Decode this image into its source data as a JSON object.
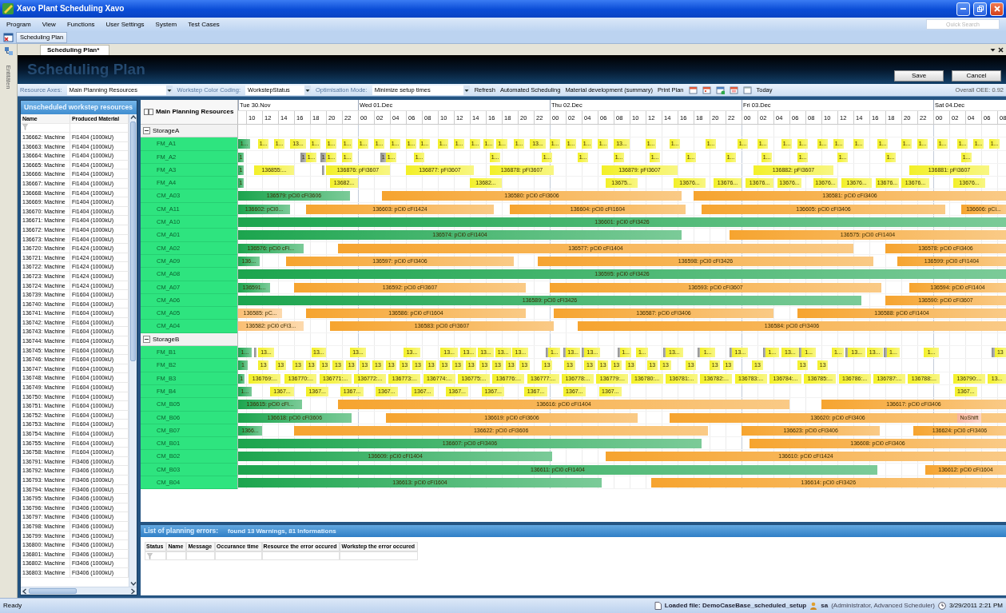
{
  "window": {
    "title": "Xavo Plant Scheduling Xavo"
  },
  "menu": [
    "Program",
    "View",
    "Functions",
    "User Settings",
    "System",
    "Test Cases"
  ],
  "quick_search": {
    "placeholder": "Quick Search"
  },
  "toolbar": {
    "buttons": [
      "Scheduling Plan"
    ]
  },
  "side_strip": {
    "label": "Entitäten"
  },
  "document_tabs": [
    {
      "label": "Scheduling Plan*",
      "selected": true
    }
  ],
  "header": {
    "title": "Scheduling Plan",
    "buttons": [
      "Save",
      "Cancel"
    ]
  },
  "options": {
    "fields": [
      {
        "label": "Resource Axes:",
        "value": "Main Planning Resources"
      },
      {
        "label": "Workstep Color Coding:",
        "value": "WorkstepStatus"
      },
      {
        "label": "Optimisation Mode:",
        "value": "Minimize setup times"
      }
    ],
    "actions": [
      "Refresh",
      "Automated Scheduling",
      "Material development (summary)",
      "Print Plan"
    ],
    "today": "Today",
    "oee_label": "Overall OEE:",
    "oee_value": "0.92"
  },
  "unscheduled": {
    "title": "Unscheduled workstep resources",
    "columns": [
      "Name",
      "Produced Material"
    ],
    "rows": [
      [
        "136662: Machine",
        "Fi1404 (1000kU)"
      ],
      [
        "136663: Machine",
        "Fi1404 (1000kU)"
      ],
      [
        "136664: Machine",
        "Fi1404 (1000kU)"
      ],
      [
        "136665: Machine",
        "Fi1404 (1000kU)"
      ],
      [
        "136666: Machine",
        "Fi1404 (1000kU)"
      ],
      [
        "136667: Machine",
        "Fi1404 (1000kU)"
      ],
      [
        "136668: Machine",
        "Fi1404 (1000kU)"
      ],
      [
        "136669: Machine",
        "Fi1404 (1000kU)"
      ],
      [
        "136670: Machine",
        "Fi1404 (1000kU)"
      ],
      [
        "136671: Machine",
        "Fi1404 (1000kU)"
      ],
      [
        "136672: Machine",
        "Fi1404 (1000kU)"
      ],
      [
        "136673: Machine",
        "Fi1404 (1000kU)"
      ],
      [
        "136720: Machine",
        "Fi1424 (1000kU)"
      ],
      [
        "136721: Machine",
        "Fi1424 (1000kU)"
      ],
      [
        "136722: Machine",
        "Fi1424 (1000kU)"
      ],
      [
        "136723: Machine",
        "Fi1424 (1000kU)"
      ],
      [
        "136724: Machine",
        "Fi1424 (1000kU)"
      ],
      [
        "136739: Machine",
        "Fi1604 (1000kU)"
      ],
      [
        "136740: Machine",
        "Fi1604 (1000kU)"
      ],
      [
        "136741: Machine",
        "Fi1604 (1000kU)"
      ],
      [
        "136742: Machine",
        "Fi1604 (1000kU)"
      ],
      [
        "136743: Machine",
        "Fi1604 (1000kU)"
      ],
      [
        "136744: Machine",
        "Fi1604 (1000kU)"
      ],
      [
        "136745: Machine",
        "Fi1604 (1000kU)"
      ],
      [
        "136746: Machine",
        "Fi1604 (1000kU)"
      ],
      [
        "136747: Machine",
        "Fi1604 (1000kU)"
      ],
      [
        "136748: Machine",
        "Fi1604 (1000kU)"
      ],
      [
        "136749: Machine",
        "Fi1604 (1000kU)"
      ],
      [
        "136750: Machine",
        "Fi1604 (1000kU)"
      ],
      [
        "136751: Machine",
        "Fi1604 (1000kU)"
      ],
      [
        "136752: Machine",
        "Fi1604 (1000kU)"
      ],
      [
        "136753: Machine",
        "Fi1604 (1000kU)"
      ],
      [
        "136754: Machine",
        "Fi1604 (1000kU)"
      ],
      [
        "136755: Machine",
        "Fi1604 (1000kU)"
      ],
      [
        "136758: Machine",
        "Fi1604 (1000kU)"
      ],
      [
        "136791: Machine",
        "Fi3406 (1000kU)"
      ],
      [
        "136792: Machine",
        "Fi3406 (1000kU)"
      ],
      [
        "136793: Machine",
        "Fi3406 (1000kU)"
      ],
      [
        "136794: Machine",
        "Fi3406 (1000kU)"
      ],
      [
        "136795: Machine",
        "Fi3406 (1000kU)"
      ],
      [
        "136796: Machine",
        "Fi3406 (1000kU)"
      ],
      [
        "136797: Machine",
        "Fi3406 (1000kU)"
      ],
      [
        "136798: Machine",
        "Fi3406 (1000kU)"
      ],
      [
        "136799: Machine",
        "Fi3406 (1000kU)"
      ],
      [
        "136800: Machine",
        "Fi3406 (1000kU)"
      ],
      [
        "136801: Machine",
        "Fi3406 (1000kU)"
      ],
      [
        "136802: Machine",
        "Fi3406 (1000kU)"
      ],
      [
        "136803: Machine",
        "Fi3406 (1000kU)"
      ]
    ]
  },
  "gantt": {
    "resource_header": "Main Planning Resources",
    "days": [
      {
        "label": "Tue 30.Nov",
        "hours": [
          "10",
          "12",
          "14",
          "16",
          "18",
          "20",
          "22"
        ]
      },
      {
        "label": "Wed 01.Dec",
        "hours": [
          "00",
          "02",
          "04",
          "06",
          "08",
          "10",
          "12",
          "14",
          "16",
          "18",
          "20",
          "22"
        ]
      },
      {
        "label": "Thu 02.Dec",
        "hours": [
          "00",
          "02",
          "04",
          "06",
          "08",
          "10",
          "12",
          "14",
          "16",
          "18",
          "20",
          "22"
        ]
      },
      {
        "label": "Fri 03.Dec",
        "hours": [
          "00",
          "02",
          "04",
          "06",
          "08",
          "10",
          "12",
          "14",
          "16",
          "18",
          "20",
          "22"
        ]
      },
      {
        "label": "Sat 04.Dec",
        "hours": [
          "00",
          "02",
          "04",
          "06",
          "08"
        ]
      }
    ],
    "groups": [
      {
        "name": "StorageA",
        "expanded": true,
        "resources": [
          {
            "name": "FM_A1",
            "bars": [
              {
                "text": "1...",
                "color": "#1ca54e"
              },
              {
                "text": "1...",
                "color": "#f3f028"
              },
              {
                "text": "1...",
                "color": "#f3f028"
              },
              {
                "text": "13...",
                "color": "#f3f028"
              },
              {
                "text": "1...",
                "color": "#f3f028"
              },
              {
                "text": "1...",
                "color": "#f3f028"
              },
              {
                "text": "1...",
                "color": "#f3f028"
              },
              {
                "text": "1...",
                "color": "#f3f028"
              },
              {
                "text": "1...",
                "color": "#f3f028"
              },
              {
                "text": "1...",
                "color": "#f3f028"
              },
              {
                "text": "1...",
                "color": "#f3f028"
              },
              {
                "text": "1...",
                "color": "#f3f028"
              },
              {
                "text": "1...",
                "color": "#f3f028"
              },
              {
                "text": "1...",
                "color": "#f3f028"
              },
              {
                "text": "1...",
                "color": "#f3f028"
              },
              {
                "text": "1...",
                "color": "#f3f028"
              },
              {
                "text": "1...",
                "color": "#f3f028"
              },
              {
                "text": "1...",
                "color": "#f3f028"
              },
              {
                "text": "13...",
                "color": "#f3f028"
              },
              {
                "text": "1...",
                "color": "#f3f028"
              },
              {
                "text": "1...",
                "color": "#f3f028"
              },
              {
                "text": "1...",
                "color": "#f3f028"
              },
              {
                "text": "1...",
                "color": "#f3f028"
              },
              {
                "text": "13...",
                "color": "#f3f028"
              },
              {
                "text": "1...",
                "color": "#f3f028"
              },
              {
                "text": "1...",
                "color": "#f3f028"
              },
              {
                "text": "1...",
                "color": "#f3f028"
              },
              {
                "text": "1...",
                "color": "#f3f028"
              },
              {
                "text": "1...",
                "color": "#f3f028"
              },
              {
                "text": "1...",
                "color": "#f3f028"
              },
              {
                "text": "1...",
                "color": "#f3f028"
              },
              {
                "text": "1...",
                "color": "#f3f028"
              },
              {
                "text": "1...",
                "color": "#f3f028"
              },
              {
                "text": "1...",
                "color": "#f3f028"
              },
              {
                "text": "1...",
                "color": "#f3f028"
              },
              {
                "text": "1...",
                "color": "#f3f028"
              },
              {
                "text": "1...",
                "color": "#f3f028"
              },
              {
                "text": "1...",
                "color": "#f3f028"
              },
              {
                "text": "1...",
                "color": "#f3f028"
              },
              {
                "text": "1...",
                "color": "#f3f028"
              },
              {
                "text": "1...",
                "color": "#f3f028"
              }
            ]
          },
          {
            "name": "FM_A2",
            "bars": [
              {
                "text": "1",
                "color": "#1ca54e"
              },
              {
                "text": "1",
                "color": "#8a8a8a"
              },
              {
                "text": "1...",
                "color": "#f3f028"
              },
              {
                "text": "1",
                "color": "#8a8a8a"
              },
              {
                "text": "1...",
                "color": "#f3f028"
              },
              {
                "text": "1...",
                "color": "#f3f028"
              },
              {
                "text": "1",
                "color": "#8a8a8a"
              },
              {
                "text": "1...",
                "color": "#f3f028"
              },
              {
                "text": "1...",
                "color": "#f3f028"
              },
              {
                "text": "1...",
                "color": "#f3f028"
              },
              {
                "text": "1...",
                "color": "#f3f028"
              },
              {
                "text": "1...",
                "color": "#f3f028"
              },
              {
                "text": "1...",
                "color": "#f3f028"
              },
              {
                "text": "1...",
                "color": "#f3f028"
              },
              {
                "text": "1...",
                "color": "#f3f028"
              },
              {
                "text": "1...",
                "color": "#f3f028"
              },
              {
                "text": "1...",
                "color": "#f3f028"
              },
              {
                "text": "1...",
                "color": "#f3f028"
              },
              {
                "text": "1...",
                "color": "#f3f028"
              },
              {
                "text": "1...",
                "color": "#f3f028"
              },
              {
                "text": "1...",
                "color": "#f3f028"
              }
            ]
          },
          {
            "name": "FM_A3",
            "bars": [
              {
                "text": "1",
                "color": "#1ca54e"
              },
              {
                "text": "136855:...",
                "color": "#f3f028"
              },
              {
                "color": "#8a8a8a"
              },
              {
                "text": "136876: pFi3607",
                "color": "#f3f028"
              },
              {
                "text": "136877: pFi3607",
                "color": "#f3f028"
              },
              {
                "text": "136878: pFi3607",
                "color": "#f3f028"
              },
              {
                "text": "136879: pFi3607",
                "color": "#f3f028"
              },
              {
                "text": "136882: pFi3607",
                "color": "#f3f028"
              },
              {
                "text": "136881: pFi3607",
                "color": "#f3f028"
              }
            ]
          },
          {
            "name": "FM_A4",
            "bars": [
              {
                "text": "1",
                "color": "#1ca54e"
              },
              {
                "text": "13682...",
                "color": "#f3f028"
              },
              {
                "text": "13682...",
                "color": "#f3f028"
              },
              {
                "text": "13675...",
                "color": "#f3f028"
              },
              {
                "text": "13676...",
                "color": "#f3f028"
              },
              {
                "text": "13676...",
                "color": "#f3f028"
              },
              {
                "text": "13676...",
                "color": "#f3f028"
              },
              {
                "text": "13676...",
                "color": "#f3f028"
              },
              {
                "text": "13676...",
                "color": "#f3f028"
              },
              {
                "text": "13676...",
                "color": "#f3f028"
              },
              {
                "text": "13676...",
                "color": "#f3f028"
              },
              {
                "text": "13676...",
                "color": "#f3f028"
              },
              {
                "text": "13676...",
                "color": "#f3f028"
              }
            ]
          },
          {
            "name": "CM_A03",
            "bars": [
              {
                "text": "136579: pCi0 cFi3606",
                "color": "#1ca54e"
              },
              {
                "text": "136580: pCi0 cFi3606",
                "color": "#f6a42f"
              },
              {
                "text": "136581: pCi0 cFi3406",
                "color": "#f6a42f"
              }
            ]
          },
          {
            "name": "CM_A11",
            "bars": [
              {
                "text": "136602: pCi0...",
                "color": "#1ca54e"
              },
              {
                "text": "136603: pCi0 cFi1424",
                "color": "#f6a42f"
              },
              {
                "text": "136604: pCi0 cFi1604",
                "color": "#f6a42f"
              },
              {
                "text": "136605: pCi0 cFi3406",
                "color": "#f6a42f"
              },
              {
                "text": "136606: pCi...",
                "color": "#f6a42f"
              }
            ]
          },
          {
            "name": "CM_A10",
            "bars": [
              {
                "text": "136601: pCi0 cFi3426",
                "color": "#1ca54e"
              }
            ]
          },
          {
            "name": "CM_A01",
            "bars": [
              {
                "text": "136574: pCi0 cFi1404",
                "color": "#1ca54e"
              },
              {
                "text": "136575: pCi0 cFi1404",
                "color": "#f6a42f"
              }
            ]
          },
          {
            "name": "CM_A02",
            "bars": [
              {
                "text": "136576: pCi0 cFi...",
                "color": "#1ca54e"
              },
              {
                "text": "136577: pCi0 cFi1404",
                "color": "#f6a42f"
              },
              {
                "text": "136578: pCi0 cFi3406",
                "color": "#f6a42f"
              }
            ]
          },
          {
            "name": "CM_A09",
            "bars": [
              {
                "text": "136...",
                "color": "#1ca54e"
              },
              {
                "text": "136597: pCi0 cFi3406",
                "color": "#f6a42f"
              },
              {
                "text": "136598: pCi0 cFi3426",
                "color": "#f6a42f"
              },
              {
                "text": "136599: pCi0 cFi1404",
                "color": "#f6a42f"
              }
            ]
          },
          {
            "name": "CM_A08",
            "bars": [
              {
                "text": "136595: pCi0 cFi3426",
                "color": "#1ca54e"
              }
            ]
          },
          {
            "name": "CM_A07",
            "bars": [
              {
                "text": "136591...",
                "color": "#1ca54e"
              },
              {
                "text": "136592: pCi0 cFi3607",
                "color": "#f6a42f"
              },
              {
                "text": "136593: pCi0 cFi3607",
                "color": "#f6a42f"
              },
              {
                "text": "136594: pCi0 cFi1404",
                "color": "#f6a42f"
              }
            ]
          },
          {
            "name": "CM_A06",
            "bars": [
              {
                "text": "136589: pCi0 cFi3426",
                "color": "#1ca54e"
              },
              {
                "text": "136590: pCi0 cFi3607",
                "color": "#f6a42f"
              }
            ]
          },
          {
            "name": "CM_A05",
            "bars": [
              {
                "text": "136585: pC...",
                "color": "#fbbf73"
              },
              {
                "text": "136586: pCi0 cFi1604",
                "color": "#f6a42f"
              },
              {
                "text": "136587: pCi0 cFi3406",
                "color": "#f6a42f"
              },
              {
                "text": "136588: pCi0 cFi1404",
                "color": "#f6a42f"
              }
            ]
          },
          {
            "name": "CM_A04",
            "bars": [
              {
                "text": "136582: pCi0 cFi3...",
                "color": "#fbbf73"
              },
              {
                "text": "136583: pCi0 cFi3607",
                "color": "#f6a42f"
              },
              {
                "text": "136584: pCi0 cFi3406",
                "color": "#f6a42f"
              }
            ]
          }
        ]
      },
      {
        "name": "StorageB",
        "expanded": true,
        "resources": [
          {
            "name": "FM_B1",
            "bars": [
              {
                "text": "1...",
                "color": "#1ca54e"
              },
              {
                "color": "#8a8a8a"
              },
              {
                "text": "13...",
                "color": "#f3f028"
              },
              {
                "text": "13...",
                "color": "#f3f028"
              },
              {
                "text": "13...",
                "color": "#f3f028"
              },
              {
                "text": "13...",
                "color": "#f3f028"
              },
              {
                "text": "13...",
                "color": "#f3f028"
              },
              {
                "text": "13...",
                "color": "#f3f028"
              },
              {
                "text": "13...",
                "color": "#f3f028"
              },
              {
                "text": "13...",
                "color": "#f3f028"
              },
              {
                "text": "13...",
                "color": "#f3f028"
              },
              {
                "color": "#8a8a8a"
              },
              {
                "text": "1...",
                "color": "#f3f028"
              },
              {
                "color": "#8a8a8a"
              },
              {
                "text": "13...",
                "color": "#f3f028"
              },
              {
                "color": "#8a8a8a"
              },
              {
                "text": "13...",
                "color": "#f3f028"
              },
              {
                "color": "#8a8a8a"
              },
              {
                "text": "1...",
                "color": "#f3f028"
              },
              {
                "text": "1...",
                "color": "#f3f028"
              },
              {
                "color": "#8a8a8a"
              },
              {
                "text": "13...",
                "color": "#f3f028"
              },
              {
                "color": "#8a8a8a"
              },
              {
                "text": "1...",
                "color": "#f3f028"
              },
              {
                "color": "#8a8a8a"
              },
              {
                "text": "13...",
                "color": "#f3f028"
              },
              {
                "color": "#8a8a8a"
              },
              {
                "text": "1...",
                "color": "#f3f028"
              },
              {
                "text": "13...",
                "color": "#f3f028"
              },
              {
                "color": "#8a8a8a"
              },
              {
                "text": "1...",
                "color": "#f3f028"
              },
              {
                "text": "1...",
                "color": "#f3f028"
              },
              {
                "color": "#8a8a8a"
              },
              {
                "text": "13...",
                "color": "#f3f028"
              },
              {
                "text": "13...",
                "color": "#f3f028"
              },
              {
                "color": "#8a8a8a"
              },
              {
                "text": "1...",
                "color": "#f3f028"
              },
              {
                "text": "1...",
                "color": "#f3f028"
              },
              {
                "color": "#8a8a8a"
              },
              {
                "text": "13",
                "color": "#f3f028"
              }
            ]
          },
          {
            "name": "FM_B2",
            "bars": [
              {
                "text": "1",
                "color": "#1ca54e"
              },
              {
                "text": "13",
                "color": "#f3f028"
              },
              {
                "text": "13",
                "color": "#f3f028"
              },
              {
                "text": "13",
                "color": "#f3f028"
              },
              {
                "text": "13",
                "color": "#f3f028"
              },
              {
                "text": "13",
                "color": "#f3f028"
              },
              {
                "text": "13",
                "color": "#f3f028"
              },
              {
                "text": "13",
                "color": "#f3f028"
              },
              {
                "text": "13",
                "color": "#f3f028"
              },
              {
                "text": "13",
                "color": "#f3f028"
              },
              {
                "text": "13",
                "color": "#f3f028"
              },
              {
                "text": "13",
                "color": "#f3f028"
              },
              {
                "text": "13",
                "color": "#f3f028"
              },
              {
                "text": "13",
                "color": "#f3f028"
              },
              {
                "text": "13",
                "color": "#f3f028"
              },
              {
                "text": "13",
                "color": "#f3f028"
              },
              {
                "text": "13",
                "color": "#f3f028"
              },
              {
                "text": "13",
                "color": "#f3f028"
              },
              {
                "text": "13",
                "color": "#f3f028"
              },
              {
                "text": "13",
                "color": "#f3f028"
              },
              {
                "text": "13",
                "color": "#f3f028"
              },
              {
                "text": "13",
                "color": "#f3f028"
              },
              {
                "text": "13",
                "color": "#f3f028"
              },
              {
                "text": "13",
                "color": "#f3f028"
              },
              {
                "text": "13",
                "color": "#f3f028"
              },
              {
                "text": "13",
                "color": "#f3f028"
              },
              {
                "text": "13",
                "color": "#f3f028"
              },
              {
                "text": "13",
                "color": "#f3f028"
              },
              {
                "text": "13",
                "color": "#f3f028"
              },
              {
                "text": "13",
                "color": "#f3f028"
              },
              {
                "text": "13",
                "color": "#f3f028"
              },
              {
                "text": "13",
                "color": "#f3f028"
              },
              {
                "text": "13",
                "color": "#f3f028"
              },
              {
                "text": "13",
                "color": "#f3f028"
              },
              {
                "text": "13",
                "color": "#f3f028"
              }
            ]
          },
          {
            "name": "FM_B3",
            "bars": [
              {
                "text": "1",
                "color": "#1ca54e"
              },
              {
                "text": "136769:...",
                "color": "#f3f028"
              },
              {
                "text": "136770:...",
                "color": "#f3f028"
              },
              {
                "text": "136771:...",
                "color": "#f3f028"
              },
              {
                "text": "136772:...",
                "color": "#f3f028"
              },
              {
                "text": "136773:...",
                "color": "#f3f028"
              },
              {
                "text": "136774:...",
                "color": "#f3f028"
              },
              {
                "text": "136775:...",
                "color": "#f3f028"
              },
              {
                "text": "136776:...",
                "color": "#f3f028"
              },
              {
                "text": "136777:...",
                "color": "#f3f028"
              },
              {
                "text": "136778:...",
                "color": "#f3f028"
              },
              {
                "text": "136779:...",
                "color": "#f3f028"
              },
              {
                "text": "136780:...",
                "color": "#f3f028"
              },
              {
                "text": "136781:...",
                "color": "#f3f028"
              },
              {
                "text": "136782:...",
                "color": "#f3f028"
              },
              {
                "text": "136783:...",
                "color": "#f3f028"
              },
              {
                "text": "136784:...",
                "color": "#f3f028"
              },
              {
                "text": "136785:...",
                "color": "#f3f028"
              },
              {
                "text": "136786:...",
                "color": "#f3f028"
              },
              {
                "text": "136787:...",
                "color": "#f3f028"
              },
              {
                "text": "136788:...",
                "color": "#f3f028"
              },
              {
                "text": "136790:...",
                "color": "#f3f028"
              },
              {
                "text": "13...",
                "color": "#f3f028"
              }
            ]
          },
          {
            "name": "FM_B4",
            "bars": [
              {
                "text": "1...",
                "color": "#1ca54e"
              },
              {
                "text": "1367...",
                "color": "#f3f028"
              },
              {
                "text": "1367...",
                "color": "#f3f028"
              },
              {
                "text": "1367...",
                "color": "#f3f028"
              },
              {
                "text": "1367...",
                "color": "#f3f028"
              },
              {
                "text": "1367...",
                "color": "#f3f028"
              },
              {
                "text": "1367...",
                "color": "#f3f028"
              },
              {
                "text": "1367...",
                "color": "#f3f028"
              },
              {
                "text": "1367...",
                "color": "#f3f028"
              },
              {
                "text": "1367...",
                "color": "#f3f028"
              },
              {
                "text": "1367...",
                "color": "#f3f028"
              },
              {
                "text": "1367...",
                "color": "#f3f028"
              }
            ]
          },
          {
            "name": "CM_B05",
            "bars": [
              {
                "text": "136615: pCi0 cFi...",
                "color": "#1ca54e"
              },
              {
                "text": "136616: pCi0 cFi1404",
                "color": "#f6a42f"
              },
              {
                "text": "136617: pCi0 cFi3406",
                "color": "#f6a42f"
              }
            ]
          },
          {
            "name": "CM_B06",
            "bars": [
              {
                "text": "136618: pCi0 cFi3606",
                "color": "#1ca54e"
              },
              {
                "text": "136619: pCi0 cFi3606",
                "color": "#f6a42f"
              },
              {
                "text": "136620: pCi0 cFi3406",
                "color": "#f6a42f"
              },
              {
                "text": "NoShift",
                "color": "#f7b49c"
              }
            ]
          },
          {
            "name": "CM_B07",
            "bars": [
              {
                "text": "1366...",
                "color": "#1ca54e"
              },
              {
                "text": "136622: pCi0 cFi3606",
                "color": "#f6a42f"
              },
              {
                "text": "136623: pCi0 cFi3406",
                "color": "#f6a42f"
              },
              {
                "text": "136624: pCi0 cFi3406",
                "color": "#f6a42f"
              }
            ]
          },
          {
            "name": "CM_B01",
            "bars": [
              {
                "text": "136607: pCi0 cFi3406",
                "color": "#1ca54e"
              },
              {
                "text": "136608: pCi0 cFi3406",
                "color": "#f6a42f"
              }
            ]
          },
          {
            "name": "CM_B02",
            "bars": [
              {
                "text": "136609: pCi0 cFi1404",
                "color": "#1ca54e"
              },
              {
                "text": "136610: pCi0 cFi1424",
                "color": "#f6a42f"
              }
            ]
          },
          {
            "name": "CM_B03",
            "bars": [
              {
                "text": "136611: pCi0 cFi1404",
                "color": "#1ca54e"
              },
              {
                "text": "136612: pCi0 cFi1604",
                "color": "#f6a42f"
              }
            ]
          },
          {
            "name": "CM_B04",
            "bars": [
              {
                "text": "136613: pCi0 cFi1604",
                "color": "#1ca54e"
              },
              {
                "text": "136614: pCi0 cFi3426",
                "color": "#f6a42f"
              }
            ]
          }
        ]
      }
    ]
  },
  "errors": {
    "title": "List of planning errors:",
    "summary": "found 13 Warnings, 81 Informations",
    "columns": [
      "Status",
      "Name",
      "Message",
      "Occurance time",
      "Resource the error occured",
      "Workstep the error occured"
    ]
  },
  "status_bar": {
    "text": "Ready",
    "file": "Loaded file: DemoCaseBase_scheduled_setup",
    "user": "sa",
    "role": "(Administrator, Advanced Scheduler)",
    "datetime": "3/29/2011 2:21 PM"
  }
}
